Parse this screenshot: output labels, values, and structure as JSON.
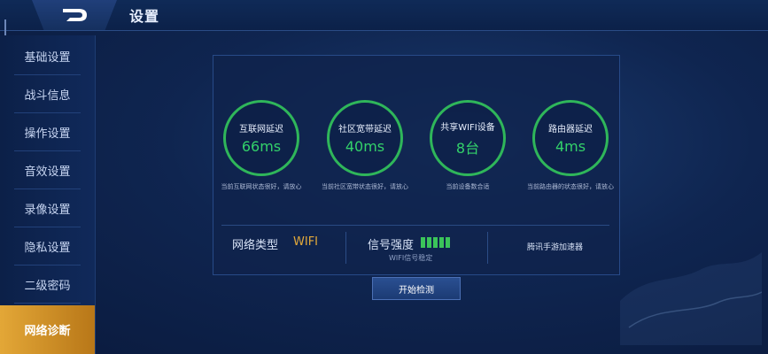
{
  "header": {
    "title": "设置",
    "back_icon": "back-arrow-icon"
  },
  "sidebar": {
    "items": [
      {
        "label": "基础设置"
      },
      {
        "label": "战斗信息"
      },
      {
        "label": "操作设置"
      },
      {
        "label": "音效设置"
      },
      {
        "label": "录像设置"
      },
      {
        "label": "隐私设置"
      },
      {
        "label": "二级密码"
      },
      {
        "label": "网络诊断",
        "active": true
      }
    ]
  },
  "diagnostics": {
    "gauges": [
      {
        "label": "互联网延迟",
        "value": "66ms",
        "note": "当前互联网状态很好，请放心"
      },
      {
        "label": "社区宽带延迟",
        "value": "40ms",
        "note": "当前社区宽带状态很好，请放心"
      },
      {
        "label": "共享WIFI设备",
        "value": "8台",
        "note": "当前设备数合适"
      },
      {
        "label": "路由器延迟",
        "value": "4ms",
        "note": "当前路由器的状态很好，请放心"
      }
    ],
    "network_type_label": "网络类型",
    "network_type_value": "WIFI",
    "signal_label": "信号强度",
    "signal_bars": 5,
    "signal_note": "WIFI信号稳定",
    "accelerator_label": "腾讯手游加速器",
    "start_button": "开始检测"
  },
  "colors": {
    "accent_gold": "#e3a93a",
    "gauge_green": "#2fb65a",
    "signal_green": "#3bc45a"
  }
}
